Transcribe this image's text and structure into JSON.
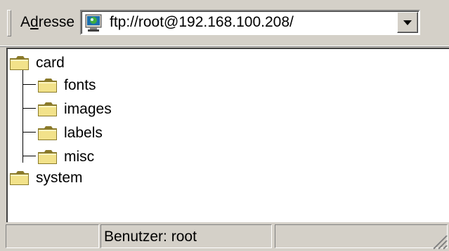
{
  "address_bar": {
    "label_prefix": "A",
    "label_accel": "d",
    "label_suffix": "resse",
    "url": "ftp://root@192.168.100.208/",
    "icon": "ftp-globe-icon"
  },
  "tree": {
    "items": [
      {
        "label": "card",
        "icon": "folder-icon",
        "level": 0
      },
      {
        "label": "fonts",
        "icon": "folder-icon",
        "level": 1
      },
      {
        "label": "images",
        "icon": "folder-icon",
        "level": 1
      },
      {
        "label": "labels",
        "icon": "folder-icon",
        "level": 1
      },
      {
        "label": "misc",
        "icon": "folder-icon",
        "level": 1
      },
      {
        "label": "system",
        "icon": "folder-icon",
        "level": 0
      }
    ]
  },
  "status_bar": {
    "panel1": "",
    "panel2": "Benutzer: root",
    "panel3": ""
  },
  "colors": {
    "face": "#d4d0c8",
    "folder": "#f2e28a",
    "folder_dark": "#8a7a2a",
    "window": "#ffffff"
  }
}
